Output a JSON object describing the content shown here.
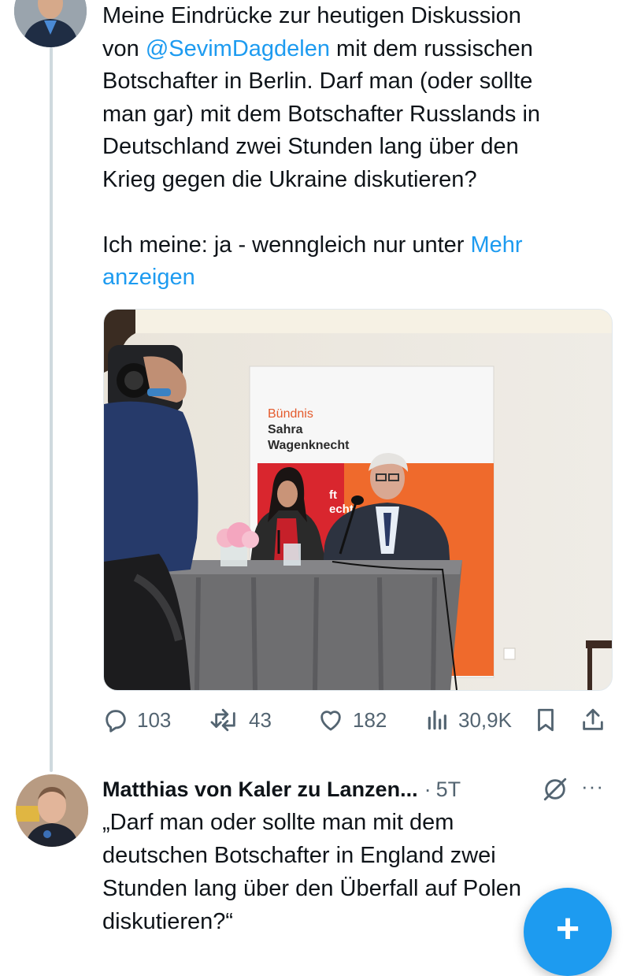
{
  "tweet": {
    "text_part1": "Meine Eindrücke zur heutigen Diskussion\nvon ",
    "mention": "@SevimDagdelen",
    "text_part2": " mit dem russischen\nBotschafter in Berlin. Darf man (oder sollte\nman gar) mit dem Botschafter Russlands in\nDeutschland zwei Stunden lang über den\nKrieg gegen die Ukraine diskutieren?\n\nIch meine: ja - wenngleich nur unter ",
    "show_more": "Mehr\nanzeigen",
    "media": {
      "banner_line1": "Bündnis",
      "banner_line2": "Sahra",
      "banner_line3": "Wagenknecht",
      "banner_partial1": "ft",
      "banner_partial2": "echt"
    }
  },
  "actions": {
    "replies": "103",
    "reposts": "43",
    "likes": "182",
    "views": "30,9K",
    "icons": [
      "reply-icon",
      "repost-icon",
      "like-icon",
      "views-icon",
      "bookmark-icon",
      "share-icon"
    ]
  },
  "reply": {
    "author": "Matthias von Kaler zu Lanzen...",
    "separator": "·",
    "time": "5T",
    "more": "···",
    "text": "„Darf man oder sollte man mit dem\ndeutschen Botschafter in England zwei\nStunden lang über den Überfall auf Polen\ndiskutieren?“"
  },
  "fab": {
    "label": "+"
  },
  "colors": {
    "accent": "#1d9bf0",
    "muted": "#536471",
    "text": "#0f1419"
  }
}
